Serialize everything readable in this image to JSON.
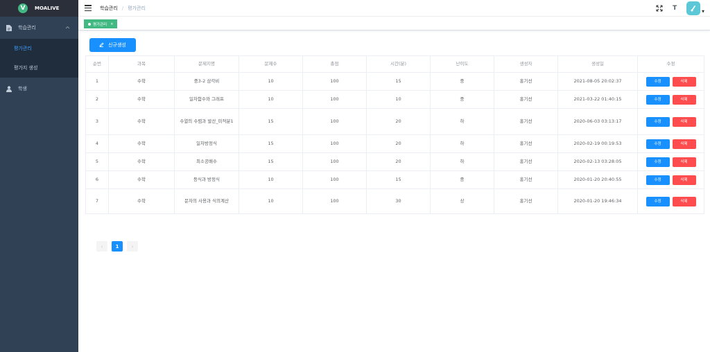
{
  "app": {
    "logo_letter": "V",
    "logo_text": "MOALIVE"
  },
  "sidebar": {
    "groups": [
      {
        "label": "학습관리",
        "icon": "document-icon",
        "expanded": true,
        "items": [
          {
            "label": "평가관리",
            "active": true
          },
          {
            "label": "평가지 생성",
            "active": false
          }
        ]
      },
      {
        "label": "학생",
        "icon": "user-icon",
        "expanded": false,
        "items": []
      }
    ]
  },
  "header": {
    "breadcrumb": [
      "학습관리",
      "평가관리"
    ],
    "breadcrumb_sep": "/",
    "font_tool": "T"
  },
  "tags": [
    {
      "label": "평가관리",
      "close": "×"
    }
  ],
  "toolbar": {
    "new_label": "신규생성"
  },
  "table": {
    "headers": [
      "순번",
      "과목",
      "문제지명",
      "문제수",
      "총점",
      "시간(분)",
      "난이도",
      "생성자",
      "생성일",
      "수정"
    ],
    "rows": [
      [
        "1",
        "수학",
        "중3-2 삼각비",
        "10",
        "100",
        "15",
        "중",
        "홍기선",
        "2021-08-05 20:02:37"
      ],
      [
        "2",
        "수학",
        "일차함수와 그래프",
        "10",
        "100",
        "10",
        "중",
        "홍기선",
        "2021-03-22 01:40:15"
      ],
      [
        "3",
        "수학",
        "수열의 수렴과 발산_미적분1",
        "15",
        "100",
        "20",
        "하",
        "홍기선",
        "2020-06-03 03:13:17"
      ],
      [
        "4",
        "수학",
        "일차방정식",
        "15",
        "100",
        "20",
        "하",
        "홍기선",
        "2020-02-19 00:19:53"
      ],
      [
        "5",
        "수학",
        "최소공배수",
        "15",
        "100",
        "20",
        "하",
        "홍기선",
        "2020-02-13 03:28:05"
      ],
      [
        "6",
        "수학",
        "등식과 방정식",
        "10",
        "100",
        "15",
        "중",
        "홍기선",
        "2020-01-20 20:40:55"
      ],
      [
        "7",
        "수학",
        "문자의 사용과 식의계산",
        "10",
        "100",
        "30",
        "상",
        "홍기선",
        "2020-01-20 19:46:34"
      ]
    ],
    "edit_label": "수정",
    "delete_label": "삭제"
  },
  "pagination": {
    "prev": "‹",
    "pages": [
      "1"
    ],
    "current": "1",
    "next": "›"
  },
  "colors": {
    "primary": "#1890ff",
    "danger": "#ff4d4f",
    "sidebar": "#304156",
    "tag": "#42b983"
  }
}
